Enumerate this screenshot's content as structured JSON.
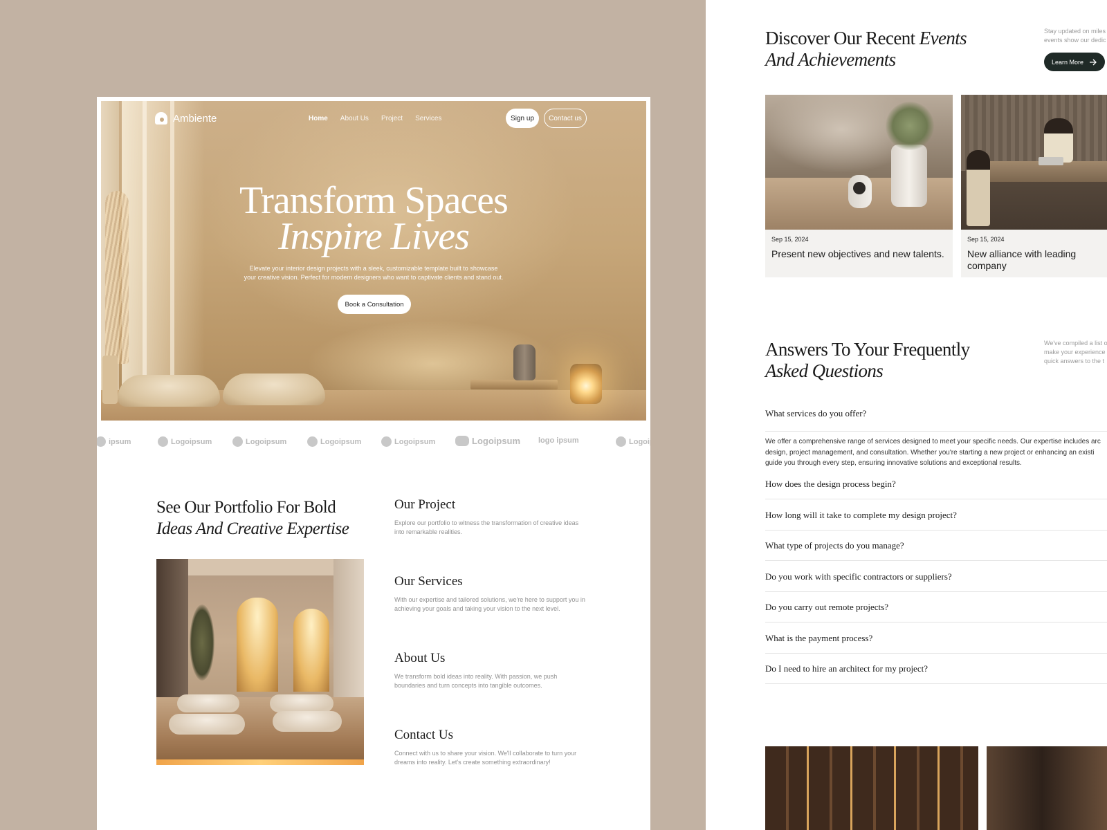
{
  "brand": {
    "name": "Ambiente"
  },
  "nav": {
    "links": [
      "Home",
      "About Us",
      "Project",
      "Services"
    ],
    "signup_label": "Sign up",
    "contact_label": "Contact us"
  },
  "hero": {
    "title_line1": "Transform Spaces",
    "title_line2": "Inspire Lives",
    "subtitle_line1": "Elevate your interior design projects with a sleek, customizable template built to showcase",
    "subtitle_line2": "your creative vision. Perfect for modern designers who want to captivate clients and stand out.",
    "cta_label": "Book a Consultation"
  },
  "logos": [
    "ipsum",
    "Logoipsum",
    "Logoipsum",
    "Logoipsum",
    "Logoipsum",
    "Logoipsum",
    "logo ipsum",
    "Logoip"
  ],
  "portfolio": {
    "title_line1": "See Our Portfolio For Bold",
    "title_line2": "Ideas And Creative Expertise",
    "items": [
      {
        "title": "Our Project",
        "desc_line1": "Explore our portfolio to witness the transformation of creative ideas",
        "desc_line2": "into remarkable realities."
      },
      {
        "title": "Our Services",
        "desc_line1": "With our expertise and tailored solutions, we're here to support you in",
        "desc_line2": "achieving your goals and taking your vision to the next level."
      },
      {
        "title": "About Us",
        "desc_line1": "We transform bold ideas into reality. With passion, we push",
        "desc_line2": "boundaries and turn concepts into tangible outcomes."
      },
      {
        "title": "Contact Us",
        "desc_line1": "Connect with us to share your vision. We'll collaborate to turn your",
        "desc_line2": "dreams into reality. Let's create something extraordinary!"
      }
    ]
  },
  "events": {
    "title_line1_plain": "Discover Our Recent ",
    "title_line1_italic": "Events",
    "title_line2": "And Achievements",
    "note_line1": "Stay updated on miles",
    "note_line2": "events show our dedic",
    "learn_more_label": "Learn More",
    "cards": [
      {
        "date": "Sep 15, 2024",
        "title": "Present new objectives and new talents."
      },
      {
        "date": "Sep 15, 2024",
        "title": "New alliance with leading company"
      }
    ]
  },
  "faq": {
    "title_line1": "Answers To Your Frequently",
    "title_line2": "Asked Questions",
    "note_line1": "We've compiled a list o",
    "note_line2": "make your experience",
    "note_line3": "quick answers to the t",
    "open_question": "What services do you offer?",
    "answer_line1": "We offer a comprehensive range of services designed to meet your specific needs. Our expertise includes arc",
    "answer_line2": "design, project management, and consultation. Whether you're starting a new project or enhancing an existi",
    "answer_line3": "guide you through every step, ensuring innovative solutions and exceptional results.",
    "questions": [
      "How does the design process begin?",
      "How long will it take to complete my design project?",
      "What type of projects do you manage?",
      "Do you work with specific contractors or suppliers?",
      "Do you carry out remote projects?",
      "What is the payment process?",
      "Do I need to hire an architect for my project?"
    ]
  },
  "colors": {
    "background": "#c2b2a3",
    "dark_button": "#1f2a27",
    "muted_text": "#8f8f8f"
  },
  "icons": [
    "logo-mark-icon",
    "arrow-right-icon",
    "logoipsum-glyph-icon"
  ]
}
